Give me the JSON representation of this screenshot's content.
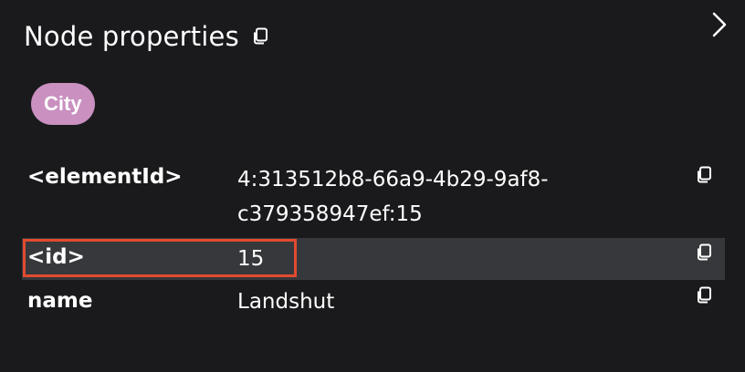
{
  "panel": {
    "title": "Node properties",
    "title_copy_icon": "copy-icon",
    "collapse_icon": "chevron-right-icon"
  },
  "labels": [
    {
      "text": "City",
      "color": "#c990c0"
    }
  ],
  "properties": [
    {
      "key": "<elementId>",
      "value_lines": [
        "4:313512b8-66a9-4b29-9af8-",
        "c379358947ef:15"
      ],
      "copy_icon": "copy-icon"
    },
    {
      "key": "<id>",
      "value": "15",
      "copy_icon": "copy-icon",
      "highlighted": true
    },
    {
      "key": "name",
      "value": "Landshut",
      "copy_icon": "copy-icon"
    }
  ],
  "colors": {
    "background": "#1a1a1c",
    "row_highlight": "#37383b",
    "focus_outline": "#e24a30"
  }
}
